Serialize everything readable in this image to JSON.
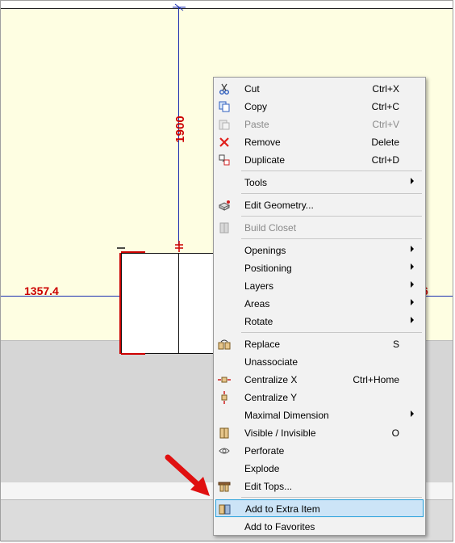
{
  "drawing": {
    "dim_vertical": "1900",
    "dim_left": "1357.4",
    "dim_right": "6"
  },
  "menu": {
    "items": [
      {
        "label": "Cut",
        "shortcut": "Ctrl+X",
        "icon": "scissors-icon"
      },
      {
        "label": "Copy",
        "shortcut": "Ctrl+C",
        "icon": "copy-icon"
      },
      {
        "label": "Paste",
        "shortcut": "Ctrl+V",
        "icon": "paste-icon",
        "disabled": true
      },
      {
        "label": "Remove",
        "shortcut": "Delete",
        "icon": "remove-x-icon"
      },
      {
        "label": "Duplicate",
        "shortcut": "Ctrl+D",
        "icon": "duplicate-icon"
      },
      {
        "label": "Tools",
        "submenu": true
      },
      {
        "label": "Edit Geometry...",
        "icon": "edit-geometry-icon"
      },
      {
        "label": "Build Closet",
        "icon": "build-closet-icon",
        "disabled": true
      },
      {
        "label": "Openings",
        "submenu": true
      },
      {
        "label": "Positioning",
        "submenu": true
      },
      {
        "label": "Layers",
        "submenu": true
      },
      {
        "label": "Areas",
        "submenu": true
      },
      {
        "label": "Rotate",
        "submenu": true
      },
      {
        "label": "Replace",
        "shortcut": "S",
        "icon": "replace-icon"
      },
      {
        "label": "Unassociate"
      },
      {
        "label": "Centralize X",
        "shortcut": "Ctrl+Home",
        "icon": "centralize-x-icon"
      },
      {
        "label": "Centralize Y",
        "icon": "centralize-y-icon"
      },
      {
        "label": "Maximal Dimension",
        "submenu": true
      },
      {
        "label": "Visible / Invisible",
        "shortcut": "O",
        "icon": "visibility-icon"
      },
      {
        "label": "Perforate",
        "icon": "perforate-icon"
      },
      {
        "label": "Explode"
      },
      {
        "label": "Edit Tops...",
        "icon": "edit-tops-icon"
      },
      {
        "label": "Add to Extra Item",
        "icon": "add-extra-item-icon",
        "highlighted": true
      },
      {
        "label": "Add to Favorites"
      }
    ]
  },
  "colors": {
    "accent": "#26a0da",
    "highlight": "#cce4f7",
    "dimension": "#cc0000",
    "dimension_line": "#1c2fb0",
    "room": "#fefee2"
  }
}
